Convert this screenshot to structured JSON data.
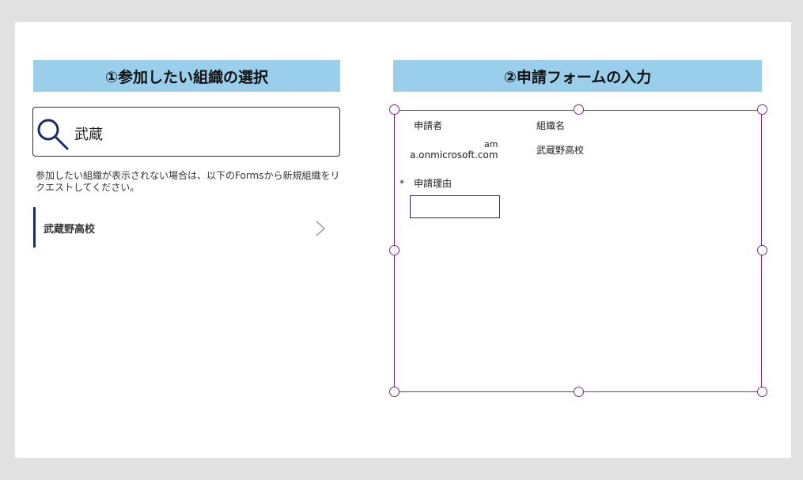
{
  "left_panel": {
    "header": "①参加したい組織の選択",
    "search": {
      "value": "武蔵"
    },
    "hint": "参加したい組織が表示されない場合は、以下のFormsから新規組織をリクエストしてください。",
    "list_items": [
      {
        "label": "武蔵野高校"
      }
    ]
  },
  "right_panel": {
    "header": "②申請フォームの入力",
    "form": {
      "applicant_label": "申請者",
      "applicant_value_line1": "am",
      "applicant_value_line2": "a.onmicrosoft.com",
      "org_label": "組織名",
      "org_value": "武蔵野高校",
      "required_mark": "*",
      "reason_label": "申請理由",
      "reason_value": ""
    }
  },
  "colors": {
    "header_bg": "#9acfec",
    "accent_navy": "#1b2a6b",
    "selection_purple": "#7d2a86",
    "background_gray": "#e1e1e1"
  },
  "icons": [
    "search-icon",
    "chevron-right-icon"
  ]
}
